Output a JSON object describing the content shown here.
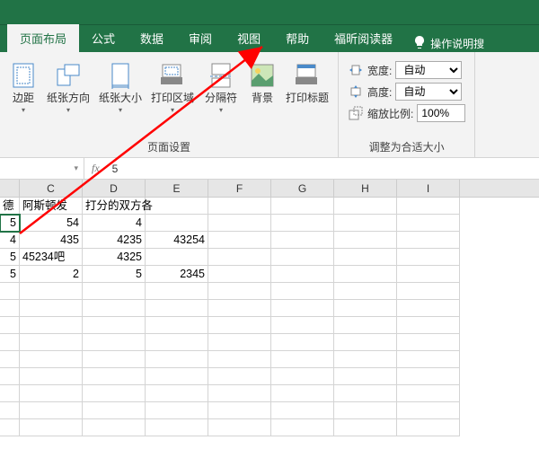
{
  "tabs": {
    "t0": "页面布局",
    "t1": "公式",
    "t2": "数据",
    "t3": "审阅",
    "t4": "视图",
    "t5": "帮助",
    "t6": "福昕阅读器"
  },
  "tell_me": "操作说明搜",
  "ribbon": {
    "margins": "边距",
    "orientation": "纸张方向",
    "size": "纸张大小",
    "print_area": "打印区域",
    "breaks": "分隔符",
    "background": "背景",
    "print_titles": "打印标题",
    "group1": "页面设置",
    "width_lbl": "宽度:",
    "width_val": "自动",
    "height_lbl": "高度:",
    "height_val": "自动",
    "scale_lbl": "缩放比例:",
    "scale_val": "100%",
    "group2": "调整为合适大小"
  },
  "fx": {
    "name": "",
    "value": "5"
  },
  "columns": [
    "C",
    "D",
    "E",
    "F",
    "G",
    "H",
    "I"
  ],
  "cells": {
    "r1c0": "德",
    "r1c1": "阿斯顿发",
    "r1c2": "打分的双方各",
    "r2c0": "5",
    "r2c1": "54",
    "r2c2": "4",
    "r3c0": "4",
    "r3c1": "435",
    "r3c2": "4235",
    "r3c3": "43254",
    "r4c0": "5",
    "r4c1": "45234吧",
    "r4c2": "4325",
    "r5c0": "5",
    "r5c1": "2",
    "r5c2": "5",
    "r5c3": "2345"
  }
}
